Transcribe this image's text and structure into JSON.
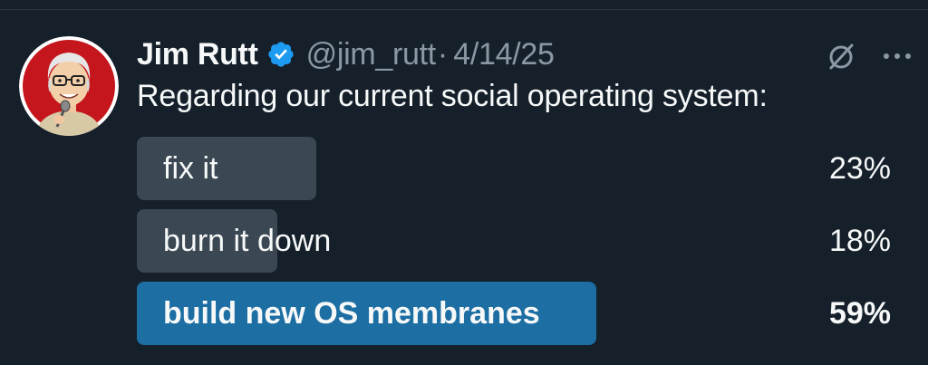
{
  "tweet": {
    "author_name": "Jim Rutt",
    "handle": "@jim_rutt",
    "separator": "·",
    "date": "4/14/25",
    "text": "Regarding our current social operating system:"
  },
  "icons": {
    "avatar": "avatar-caricature",
    "verified": "verified-badge-icon",
    "grok": "grok-slash-icon",
    "more": "more-dots-icon"
  },
  "colors": {
    "background": "#15202b",
    "verified_blue": "#1d9bf0",
    "bar_default": "#3b4753",
    "bar_winner": "#1d6ea3",
    "muted_text": "#8b98a5"
  },
  "poll": {
    "options": [
      {
        "label": "fix it",
        "percent_label": "23%",
        "fraction": 0.23,
        "winner": false
      },
      {
        "label": "burn it down",
        "percent_label": "18%",
        "fraction": 0.18,
        "winner": false
      },
      {
        "label": "build new OS membranes",
        "percent_label": "59%",
        "fraction": 0.59,
        "winner": true
      }
    ]
  }
}
